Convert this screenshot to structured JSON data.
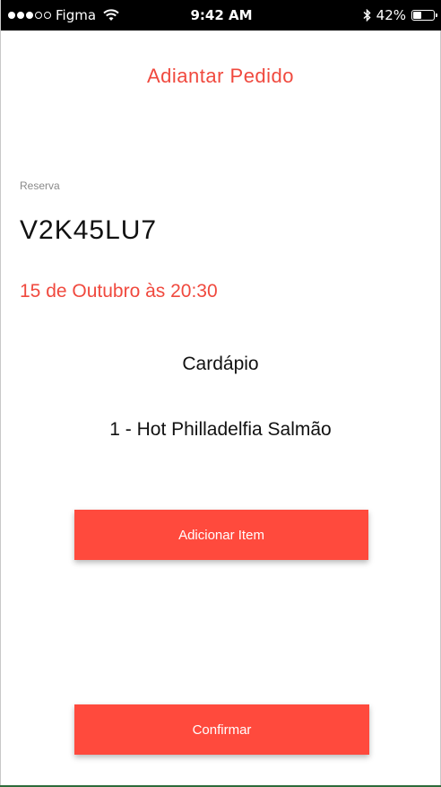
{
  "status_bar": {
    "carrier": "Figma",
    "time": "9:42 AM",
    "battery": "42%",
    "battery_level": 0.42,
    "signal_bars_filled": 3,
    "signal_bars_total": 5
  },
  "header": {
    "title": "Adiantar Pedido"
  },
  "reservation": {
    "label": "Reserva",
    "code": "V2K45LU7",
    "datetime": "15 de Outubro às 20:30"
  },
  "menu": {
    "title": "Cardápio",
    "items": [
      {
        "label": "1 - Hot Philladelfia Salmão"
      }
    ]
  },
  "buttons": {
    "add_item": "Adicionar Item",
    "confirm": "Confirmar"
  },
  "colors": {
    "accent": "#f0493e",
    "button": "#ff4a3d"
  }
}
